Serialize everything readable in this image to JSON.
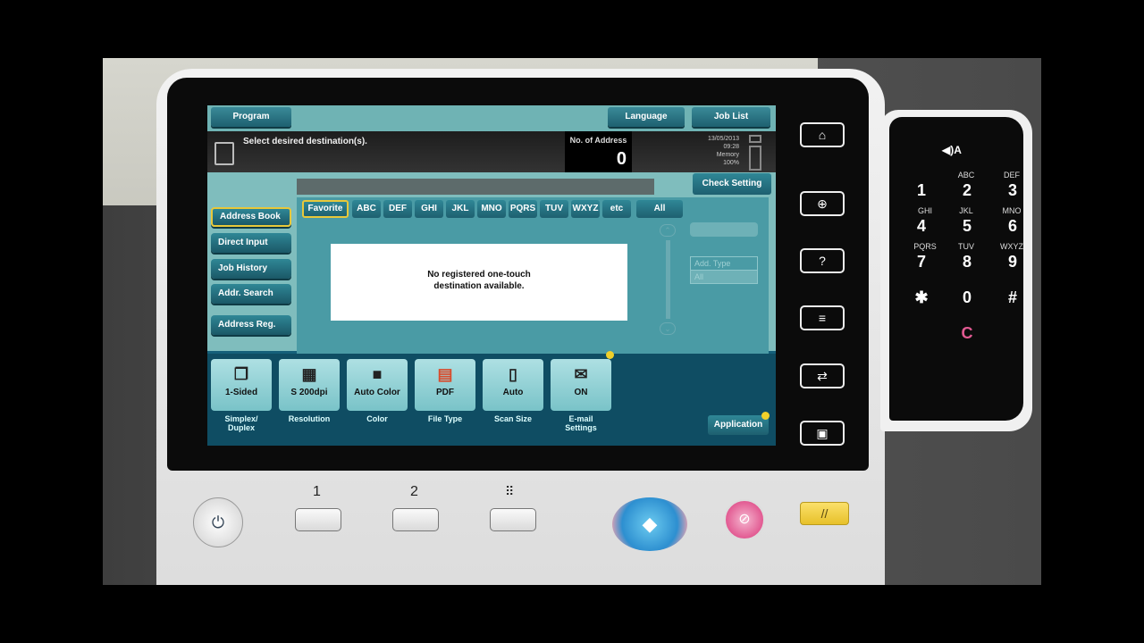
{
  "topbar": {
    "program": "Program",
    "language": "Language",
    "job_list": "Job List"
  },
  "message": "Select desired destination(s).",
  "address_count": {
    "label": "No. of Address",
    "value": "0"
  },
  "status": {
    "date": "13/05/2013",
    "time": "09:28",
    "memory_label": "Memory",
    "memory_value": "100%"
  },
  "check_setting": "Check Setting",
  "side_menu": [
    "Address Book",
    "Direct Input",
    "Job History",
    "Addr. Search",
    "Address Reg."
  ],
  "index_tabs": [
    "Favorite",
    "ABC",
    "DEF",
    "GHI",
    "JKL",
    "MNO",
    "PQRS",
    "TUV",
    "WXYZ",
    "etc",
    "All"
  ],
  "notice": {
    "line1": "No registered one-touch",
    "line2": "destination available."
  },
  "addr_type": {
    "label": "Add. Type",
    "value": "All"
  },
  "functions": [
    {
      "value": "1-Sided",
      "label1": "Simplex/",
      "label2": "Duplex",
      "icon": "duplex-icon"
    },
    {
      "value": "S 200dpi",
      "label1": "Resolution",
      "label2": "",
      "icon": "resolution-icon"
    },
    {
      "value": "Auto Color",
      "label1": "Color",
      "label2": "",
      "icon": "color-icon"
    },
    {
      "value": "PDF",
      "label1": "File Type",
      "label2": "",
      "icon": "pdf-icon"
    },
    {
      "value": "Auto",
      "label1": "Scan Size",
      "label2": "",
      "icon": "scan-size-icon"
    },
    {
      "value": "ON",
      "label1": "E-mail",
      "label2": "Settings",
      "icon": "email-icon"
    }
  ],
  "application": "Application",
  "hw_side_keys": [
    "home-icon",
    "zoom-icon",
    "help-icon",
    "access-icon",
    "counter-icon",
    "register-icon"
  ],
  "hw_side_glyphs": [
    "⌂",
    "⊕",
    "?",
    "≡",
    "⇄",
    "▣"
  ],
  "register_labels": [
    "1",
    "2"
  ],
  "keypad": {
    "top_icon": "◀)A",
    "keys": [
      {
        "digit": "1",
        "letters": ""
      },
      {
        "digit": "2",
        "letters": "ABC"
      },
      {
        "digit": "3",
        "letters": "DEF"
      },
      {
        "digit": "4",
        "letters": "GHI"
      },
      {
        "digit": "5",
        "letters": "JKL"
      },
      {
        "digit": "6",
        "letters": "MNO"
      },
      {
        "digit": "7",
        "letters": "PQRS"
      },
      {
        "digit": "8",
        "letters": "TUV"
      },
      {
        "digit": "9",
        "letters": "WXYZ"
      },
      {
        "digit": "✱",
        "letters": ""
      },
      {
        "digit": "0",
        "letters": ""
      },
      {
        "digit": "#",
        "letters": ""
      }
    ],
    "clear": "C"
  },
  "colors": {
    "accent": "#e8c83a",
    "screen_bg": "#15607a",
    "panel": "#7fbdbd",
    "clear_key": "#e25a92"
  }
}
